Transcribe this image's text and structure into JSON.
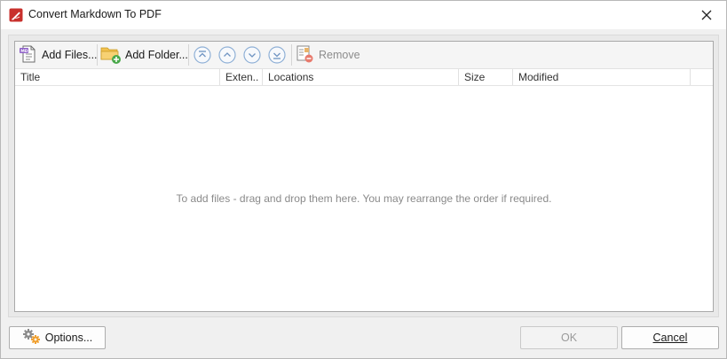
{
  "window": {
    "title": "Convert Markdown To PDF"
  },
  "toolbar": {
    "add_files_label": "Add Files...",
    "add_folder_label": "Add Folder...",
    "remove_label": "Remove",
    "move_buttons": [
      {
        "name": "move-to-top",
        "icon": "double-chevron-up-icon"
      },
      {
        "name": "move-up",
        "icon": "chevron-up-icon"
      },
      {
        "name": "move-down",
        "icon": "chevron-down-icon"
      },
      {
        "name": "move-to-bottom",
        "icon": "double-chevron-down-icon"
      }
    ]
  },
  "columns": [
    {
      "id": "title",
      "label": "Title"
    },
    {
      "id": "extension",
      "label": "Exten.."
    },
    {
      "id": "locations",
      "label": "Locations"
    },
    {
      "id": "size",
      "label": "Size"
    },
    {
      "id": "modified",
      "label": "Modified"
    }
  ],
  "list": {
    "empty_message": "To add files - drag and drop them here. You may rearrange the order if required."
  },
  "footer": {
    "options_label": "Options...",
    "ok_label": "OK",
    "cancel_label": "Cancel"
  },
  "colors": {
    "app_icon_red": "#c8302c",
    "move_button_blue": "#8fb0d6",
    "folder_yellow": "#f2c14e",
    "add_green": "#49a84a"
  }
}
